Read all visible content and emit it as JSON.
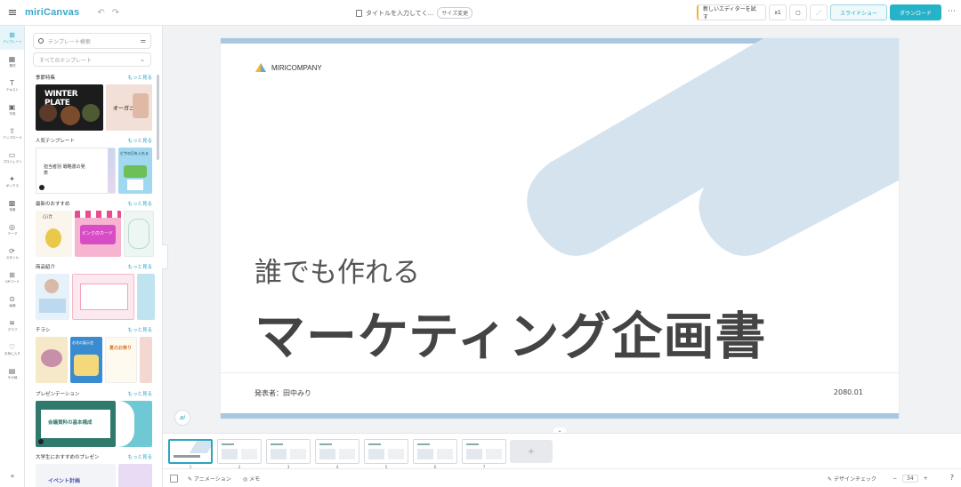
{
  "topbar": {
    "menu_icon": "hamburger-icon",
    "logo": "miriCanvas",
    "undo": "↶",
    "redo": "↷",
    "doc_title": "タイトルを入力してく...",
    "size_tag": "サイズ変更",
    "new_editor": "新しいエディターを試す",
    "zoom_btn": "x1",
    "preview": "スライドショー",
    "download": "ダウンロード",
    "more": "⋯"
  },
  "rail": {
    "items": [
      {
        "icon": "⊞",
        "label": "テンプレート"
      },
      {
        "icon": "▦",
        "label": "素材"
      },
      {
        "icon": "T",
        "label": "テキスト"
      },
      {
        "icon": "▣",
        "label": "写真"
      },
      {
        "icon": "⇪",
        "label": "アップロード"
      },
      {
        "icon": "▭",
        "label": "プロジェクト"
      },
      {
        "icon": "✦",
        "label": "ボックス"
      },
      {
        "icon": "▩",
        "label": "背景"
      },
      {
        "icon": "◎",
        "label": "テーマ"
      },
      {
        "icon": "⟳",
        "label": "スタイル"
      },
      {
        "icon": "⊞",
        "label": "QRコード"
      },
      {
        "icon": "⊙",
        "label": "画像"
      },
      {
        "icon": "≋",
        "label": "グラフ"
      },
      {
        "icon": "♡",
        "label": "お気に入り"
      },
      {
        "icon": "▤",
        "label": "その他"
      }
    ],
    "bottom": "«"
  },
  "panel": {
    "search_placeholder": "テンプレート検索",
    "select_value": "すべてのテンプレート",
    "sections": [
      {
        "title": "季節特集",
        "more": "もっと見る",
        "t1": "WINTER PLATE",
        "t2": "オーガニック"
      },
      {
        "title": "人気テンプレート",
        "more": "もっと見る",
        "t1": "担当者別 戦略書の発表",
        "t2": "ピザの日を入れる"
      },
      {
        "title": "最新のおすすめ",
        "more": "もっと見る",
        "t1": "Gift",
        "t2": "ピンクのカード"
      },
      {
        "title": "商品紹介",
        "more": "もっと見る",
        "t1": "",
        "t2": ""
      },
      {
        "title": "チラシ",
        "more": "もっと見る",
        "t1": "お花の展示会",
        "t2": "夏のお祭り"
      },
      {
        "title": "プレゼンテーション",
        "more": "もっと見る",
        "t1": "会議資料の基本構成",
        "t2": ""
      },
      {
        "title": "大学生におすすめのプレゼン",
        "more": "もっと見る",
        "t1": "イベント計画",
        "t2": ""
      }
    ]
  },
  "slide": {
    "company": "MIRICOMPANY",
    "subtitle": "誰でも作れる",
    "title": "マーケティング企画書",
    "presenter": "発表者：田中みり",
    "date": "2080.01"
  },
  "ai_button": "ai",
  "pages": [
    "1",
    "2",
    "3",
    "4",
    "5",
    "6",
    "7"
  ],
  "add_page": "+",
  "bottombar": {
    "animation": "アニメーション",
    "memo": "メモ",
    "design": "デザインチェック",
    "zoom_out": "−",
    "zoom_value": "34",
    "zoom_in": "+",
    "help": "?"
  },
  "colors": {
    "accent": "#26b3c9",
    "slide_band": "#a9c7e0",
    "stripe": "#d5e3ef"
  }
}
